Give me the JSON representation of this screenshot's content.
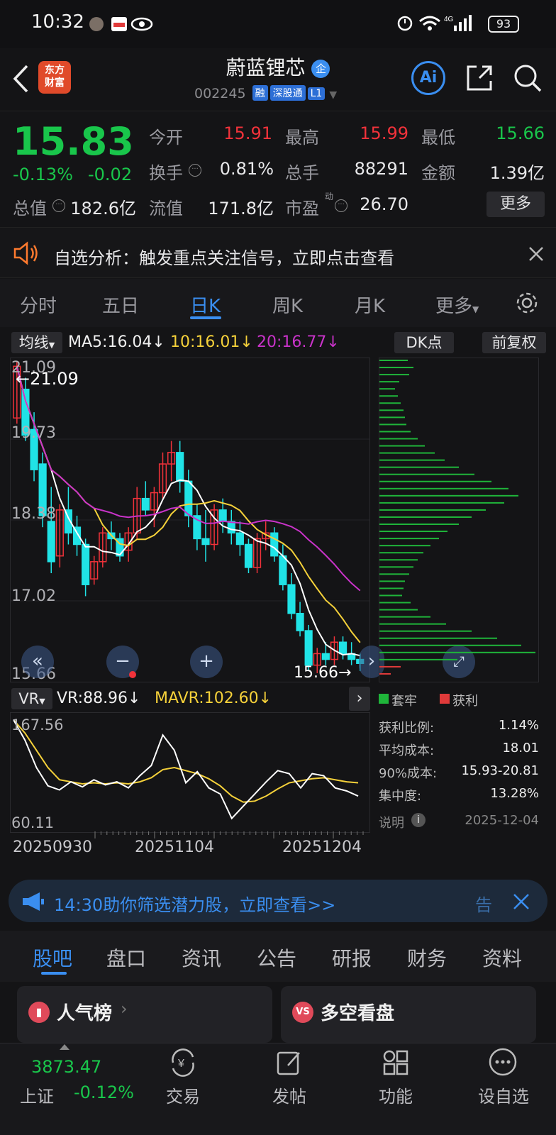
{
  "status_bar": {
    "time": "10:32",
    "battery": "93",
    "network": "4G"
  },
  "header": {
    "stock_name": "蔚蓝锂芯",
    "badge": "企",
    "code": "002245",
    "tags": [
      "融",
      "深股通",
      "L1"
    ],
    "brand": "东方财富",
    "ai_label": "Ai"
  },
  "quote": {
    "price": "15.83",
    "change_pct": "-0.13%",
    "change_amt": "-0.02",
    "open_label": "今开",
    "open": "15.91",
    "high_label": "最高",
    "high": "15.99",
    "low_label": "最低",
    "low": "15.66",
    "turnover_label": "换手",
    "turnover": "0.81%",
    "volume_label": "总手",
    "volume": "88291",
    "amount_label": "金额",
    "amount": "1.39亿",
    "mktcap_label": "总值",
    "mktcap": "182.6亿",
    "float_label": "流值",
    "float": "171.8亿",
    "pe_label": "市盈",
    "pe_sup": "动",
    "pe": "26.70",
    "more": "更多"
  },
  "notice": {
    "text": "自选分析：触发重点关注信号，立即点击查看"
  },
  "tabs": [
    "分时",
    "五日",
    "日K",
    "周K",
    "月K",
    "更多"
  ],
  "active_tab": 2,
  "ma_bar": {
    "selector": "均线",
    "ma5": "MA5:16.04↓",
    "ma10": "10:16.01↓",
    "ma20": "20:16.77↓",
    "dk": "DK点",
    "adjust": "前复权"
  },
  "chart_data": {
    "type": "candlestick",
    "y_ticks": [
      "21.09",
      "19.73",
      "18.38",
      "17.02",
      "15.66"
    ],
    "ylim": [
      15.66,
      21.09
    ],
    "max_marker": "←21.09",
    "min_marker": "15.66→",
    "x_ticks": [
      "20250930",
      "20251104",
      "20251204"
    ],
    "candles": [
      [
        20.1,
        21.09,
        20.0,
        21.0
      ],
      [
        20.6,
        20.8,
        19.7,
        19.8
      ],
      [
        19.9,
        20.2,
        19.0,
        19.2
      ],
      [
        19.3,
        19.5,
        18.2,
        18.4
      ],
      [
        18.3,
        18.9,
        17.4,
        17.6
      ],
      [
        17.7,
        18.6,
        17.5,
        18.5
      ],
      [
        18.5,
        18.9,
        17.9,
        18.1
      ],
      [
        18.2,
        18.4,
        17.7,
        17.9
      ],
      [
        17.9,
        18.0,
        17.0,
        17.2
      ],
      [
        17.3,
        17.7,
        17.2,
        17.6
      ],
      [
        17.6,
        18.2,
        17.5,
        18.1
      ],
      [
        18.1,
        18.3,
        17.8,
        18.0
      ],
      [
        18.0,
        18.1,
        17.6,
        17.7
      ],
      [
        17.8,
        18.2,
        17.6,
        18.1
      ],
      [
        18.1,
        18.9,
        18.0,
        18.7
      ],
      [
        18.7,
        19.0,
        18.4,
        18.5
      ],
      [
        18.5,
        18.9,
        18.2,
        18.8
      ],
      [
        18.8,
        19.5,
        18.7,
        19.3
      ],
      [
        19.3,
        19.7,
        19.0,
        19.5
      ],
      [
        19.5,
        19.7,
        18.8,
        19.0
      ],
      [
        19.0,
        19.2,
        18.2,
        18.4
      ],
      [
        18.4,
        18.6,
        17.8,
        18.0
      ],
      [
        18.0,
        18.5,
        17.6,
        17.9
      ],
      [
        17.9,
        18.6,
        17.8,
        18.5
      ],
      [
        18.5,
        18.7,
        18.1,
        18.3
      ],
      [
        18.3,
        18.5,
        17.9,
        18.1
      ],
      [
        18.1,
        18.3,
        17.7,
        17.9
      ],
      [
        17.9,
        18.0,
        17.4,
        17.5
      ],
      [
        17.5,
        18.1,
        17.4,
        18.0
      ],
      [
        18.0,
        18.3,
        17.8,
        18.1
      ],
      [
        18.1,
        18.2,
        17.6,
        17.7
      ],
      [
        17.7,
        17.9,
        17.1,
        17.2
      ],
      [
        17.2,
        17.4,
        16.6,
        16.7
      ],
      [
        16.7,
        16.9,
        16.3,
        16.4
      ],
      [
        16.4,
        16.5,
        15.7,
        15.8
      ],
      [
        15.8,
        16.1,
        15.66,
        16.0
      ],
      [
        16.0,
        16.2,
        15.8,
        15.9
      ],
      [
        15.9,
        16.3,
        15.8,
        16.2
      ],
      [
        16.2,
        16.3,
        15.9,
        16.0
      ],
      [
        16.0,
        16.2,
        15.8,
        15.9
      ],
      [
        15.9,
        16.0,
        15.7,
        15.83
      ]
    ],
    "ma5_label": "MA5",
    "ma10_label": "10",
    "ma20_label": "20"
  },
  "dk_panel": {
    "legend_hold": "套牢",
    "legend_profit": "获利",
    "rows": [
      {
        "label": "获利比例:",
        "value": "1.14%"
      },
      {
        "label": "平均成本:",
        "value": "18.01"
      },
      {
        "label": "90%成本:",
        "value": "15.93-20.81"
      },
      {
        "label": "集中度:",
        "value": "13.28%"
      }
    ],
    "note_label": "说明",
    "date": "2025-12-04"
  },
  "vr": {
    "selector": "VR",
    "vr": "VR:88.96↓",
    "mavr": "MAVR:102.60↓",
    "y_max": "167.56",
    "y_min": "60.11",
    "vr_series": [
      165,
      145,
      118,
      100,
      96,
      104,
      99,
      106,
      101,
      104,
      98,
      110,
      120,
      150,
      135,
      103,
      114,
      98,
      92,
      68,
      80,
      92,
      104,
      115,
      112,
      98,
      112,
      110,
      98,
      95,
      90
    ],
    "mavr_series": [
      165,
      152,
      135,
      118,
      106,
      104,
      102,
      103,
      102,
      103,
      102,
      104,
      108,
      116,
      118,
      115,
      112,
      107,
      100,
      90,
      84,
      85,
      90,
      97,
      103,
      105,
      107,
      108,
      106,
      104,
      103
    ]
  },
  "banner": {
    "text": "14:30助你筛选潜力股，立即查看>>",
    "side": "告"
  },
  "sections": [
    "股吧",
    "盘口",
    "资讯",
    "公告",
    "研报",
    "财务",
    "资料"
  ],
  "cards": {
    "left": "人气榜",
    "right": "多空看盘"
  },
  "bottom_nav": {
    "index_value": "3873.47",
    "index_name": "上证",
    "index_change": "-0.12%",
    "items": [
      "交易",
      "发帖",
      "功能",
      "设自选"
    ]
  }
}
